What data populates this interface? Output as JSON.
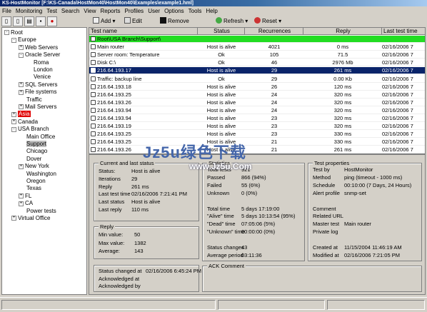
{
  "window": {
    "title": "KS-HostMonitor   [F:\\KS-Canada\\HostMon40\\HostMon40\\Examples\\example1.hml]"
  },
  "menu": [
    "File",
    "Monitoring",
    "Test",
    "Search",
    "View",
    "Reports",
    "Profiles",
    "User",
    "Options",
    "Tools",
    "Help"
  ],
  "toolbar": {
    "add": "Add",
    "edit": "Edit",
    "remove": "Remove",
    "refresh": "Refresh",
    "reset": "Reset"
  },
  "tree": [
    {
      "label": "Root",
      "exp": "-"
    },
    {
      "label": "Europe",
      "exp": "-"
    },
    {
      "label": "Web Servers",
      "exp": "+"
    },
    {
      "label": "Oracle Server",
      "exp": "-"
    },
    {
      "label": "Roma",
      "exp": ""
    },
    {
      "label": "London",
      "exp": ""
    },
    {
      "label": "Venice",
      "exp": ""
    },
    {
      "label": "SQL Servers",
      "exp": "+"
    },
    {
      "label": "File systems",
      "exp": "+"
    },
    {
      "label": "Traffic",
      "exp": ""
    },
    {
      "label": "Mail Servers",
      "exp": "+"
    },
    {
      "label": "Asia",
      "exp": "+"
    },
    {
      "label": "Canada",
      "exp": "+"
    },
    {
      "label": "USA Branch",
      "exp": "-"
    },
    {
      "label": "Main Office",
      "exp": ""
    },
    {
      "label": "Support",
      "exp": ""
    },
    {
      "label": "Chicago",
      "exp": ""
    },
    {
      "label": "Dover",
      "exp": ""
    },
    {
      "label": "New York",
      "exp": "+"
    },
    {
      "label": "Washington",
      "exp": ""
    },
    {
      "label": "Oregon",
      "exp": ""
    },
    {
      "label": "Texas",
      "exp": ""
    },
    {
      "label": "FL",
      "exp": "+"
    },
    {
      "label": "CA",
      "exp": "+"
    },
    {
      "label": "Power tests",
      "exp": ""
    },
    {
      "label": "Virtual Office",
      "exp": "+"
    }
  ],
  "grid": {
    "columns": [
      "Test name",
      "Status",
      "Recurrences",
      "Reply",
      "Last test time"
    ],
    "rows": [
      [
        "Root\\USA Branch\\Support\\",
        "",
        "",
        "",
        ""
      ],
      [
        "Main router",
        "Host is alive",
        "4021",
        "0 ms",
        "02/16/2006 7"
      ],
      [
        "Server room: Temperature",
        "Ok",
        "105",
        "71.5",
        "02/16/2006 7"
      ],
      [
        "Disk C:\\",
        "Ok",
        "46",
        "2976 Mb",
        "02/16/2006 7"
      ],
      [
        "216.64.193.17",
        "Host is alive",
        "29",
        "261 ms",
        "02/16/2006 7"
      ],
      [
        "Traffic: backup line",
        "Ok",
        "29",
        "0.00 Kb",
        "02/16/2006 7"
      ],
      [
        "216.64.193.18",
        "Host is alive",
        "26",
        "120 ms",
        "02/16/2006 7"
      ],
      [
        "216.64.193.25",
        "Host is alive",
        "24",
        "320 ms",
        "02/16/2006 7"
      ],
      [
        "216.64.193.26",
        "Host is alive",
        "24",
        "320 ms",
        "02/16/2006 7"
      ],
      [
        "216.64.193.94",
        "Host is alive",
        "24",
        "320 ms",
        "02/16/2006 7"
      ],
      [
        "216.64.193.94",
        "Host is alive",
        "23",
        "320 ms",
        "02/16/2006 7"
      ],
      [
        "216.64.193.19",
        "Host is alive",
        "23",
        "320 ms",
        "02/16/2006 7"
      ],
      [
        "216.64.193.25",
        "Host is alive",
        "23",
        "330 ms",
        "02/16/2006 7"
      ],
      [
        "216.64.193.25",
        "Host is alive",
        "21",
        "330 ms",
        "02/16/2006 7"
      ],
      [
        "216.64.193.26",
        "Host is alive",
        "21",
        "261 ms",
        "02/16/2006 7"
      ]
    ]
  },
  "current": {
    "title": "Current and last status",
    "items": [
      [
        "Status:",
        "Host is alive"
      ],
      [
        "Iterations",
        "29"
      ],
      [
        "Reply",
        "261 ms"
      ],
      [
        "Last test time",
        "02/16/2006 7:21:41 PM"
      ],
      [
        "Last status",
        "Host is alive"
      ],
      [
        "Last reply",
        "110 ms"
      ]
    ]
  },
  "reply": {
    "title": "Reply",
    "items": [
      [
        "Min value:",
        "50"
      ],
      [
        "Max value:",
        "1382"
      ],
      [
        "Average:",
        "143"
      ]
    ]
  },
  "changed": {
    "items": [
      [
        "Status changed at",
        "02/16/2006 6:45:24 PM"
      ],
      [
        "Acknowledged at",
        ""
      ],
      [
        "Acknowledged by",
        ""
      ]
    ]
  },
  "stats": {
    "title": "Statistics",
    "items": [
      [
        "Total tests",
        "921"
      ],
      [
        "Passed",
        "866 (94%)"
      ],
      [
        "Failed",
        "55 (6%)"
      ],
      [
        "Unknown",
        "0 (0%)"
      ],
      [
        "",
        ""
      ],
      [
        "Total time",
        "5 days 17:19:00"
      ],
      [
        "\"Alive\" time",
        "5 days 10:13:54 (95%)"
      ],
      [
        "\"Dead\" time",
        "07:05:06 (5%)"
      ],
      [
        "\"Unknown\" time",
        "00:00:00 (0%)"
      ],
      [
        "",
        ""
      ],
      [
        "Status changes",
        "43"
      ],
      [
        "Average period",
        "03:11:36"
      ]
    ]
  },
  "ack": {
    "title": "ACK Comment"
  },
  "props": {
    "title": "Test properties",
    "items": [
      [
        "Test by",
        "HostMonitor"
      ],
      [
        "Method",
        "ping (timeout - 1000 ms)"
      ],
      [
        "Schedule",
        "00:10:00 (7 Days, 24 Hours)"
      ],
      [
        "Alert profile",
        "snmp-set"
      ],
      [
        "",
        ""
      ],
      [
        "Comment",
        ""
      ],
      [
        "Related URL",
        ""
      ],
      [
        "Master test",
        "Main router"
      ],
      [
        "Private log",
        ""
      ],
      [
        "",
        ""
      ],
      [
        "Created at",
        "11/15/2004 11:46:19 AM"
      ],
      [
        "Modified at",
        "02/16/2006 7:21:05 PM"
      ]
    ]
  },
  "watermark": {
    "main": "Jz5u绿色下载",
    "sub": "www.Jz5u.Com"
  },
  "colors": {
    "folder": "#22dd22",
    "selection": "#0a246a",
    "alarm": "#e00000"
  }
}
